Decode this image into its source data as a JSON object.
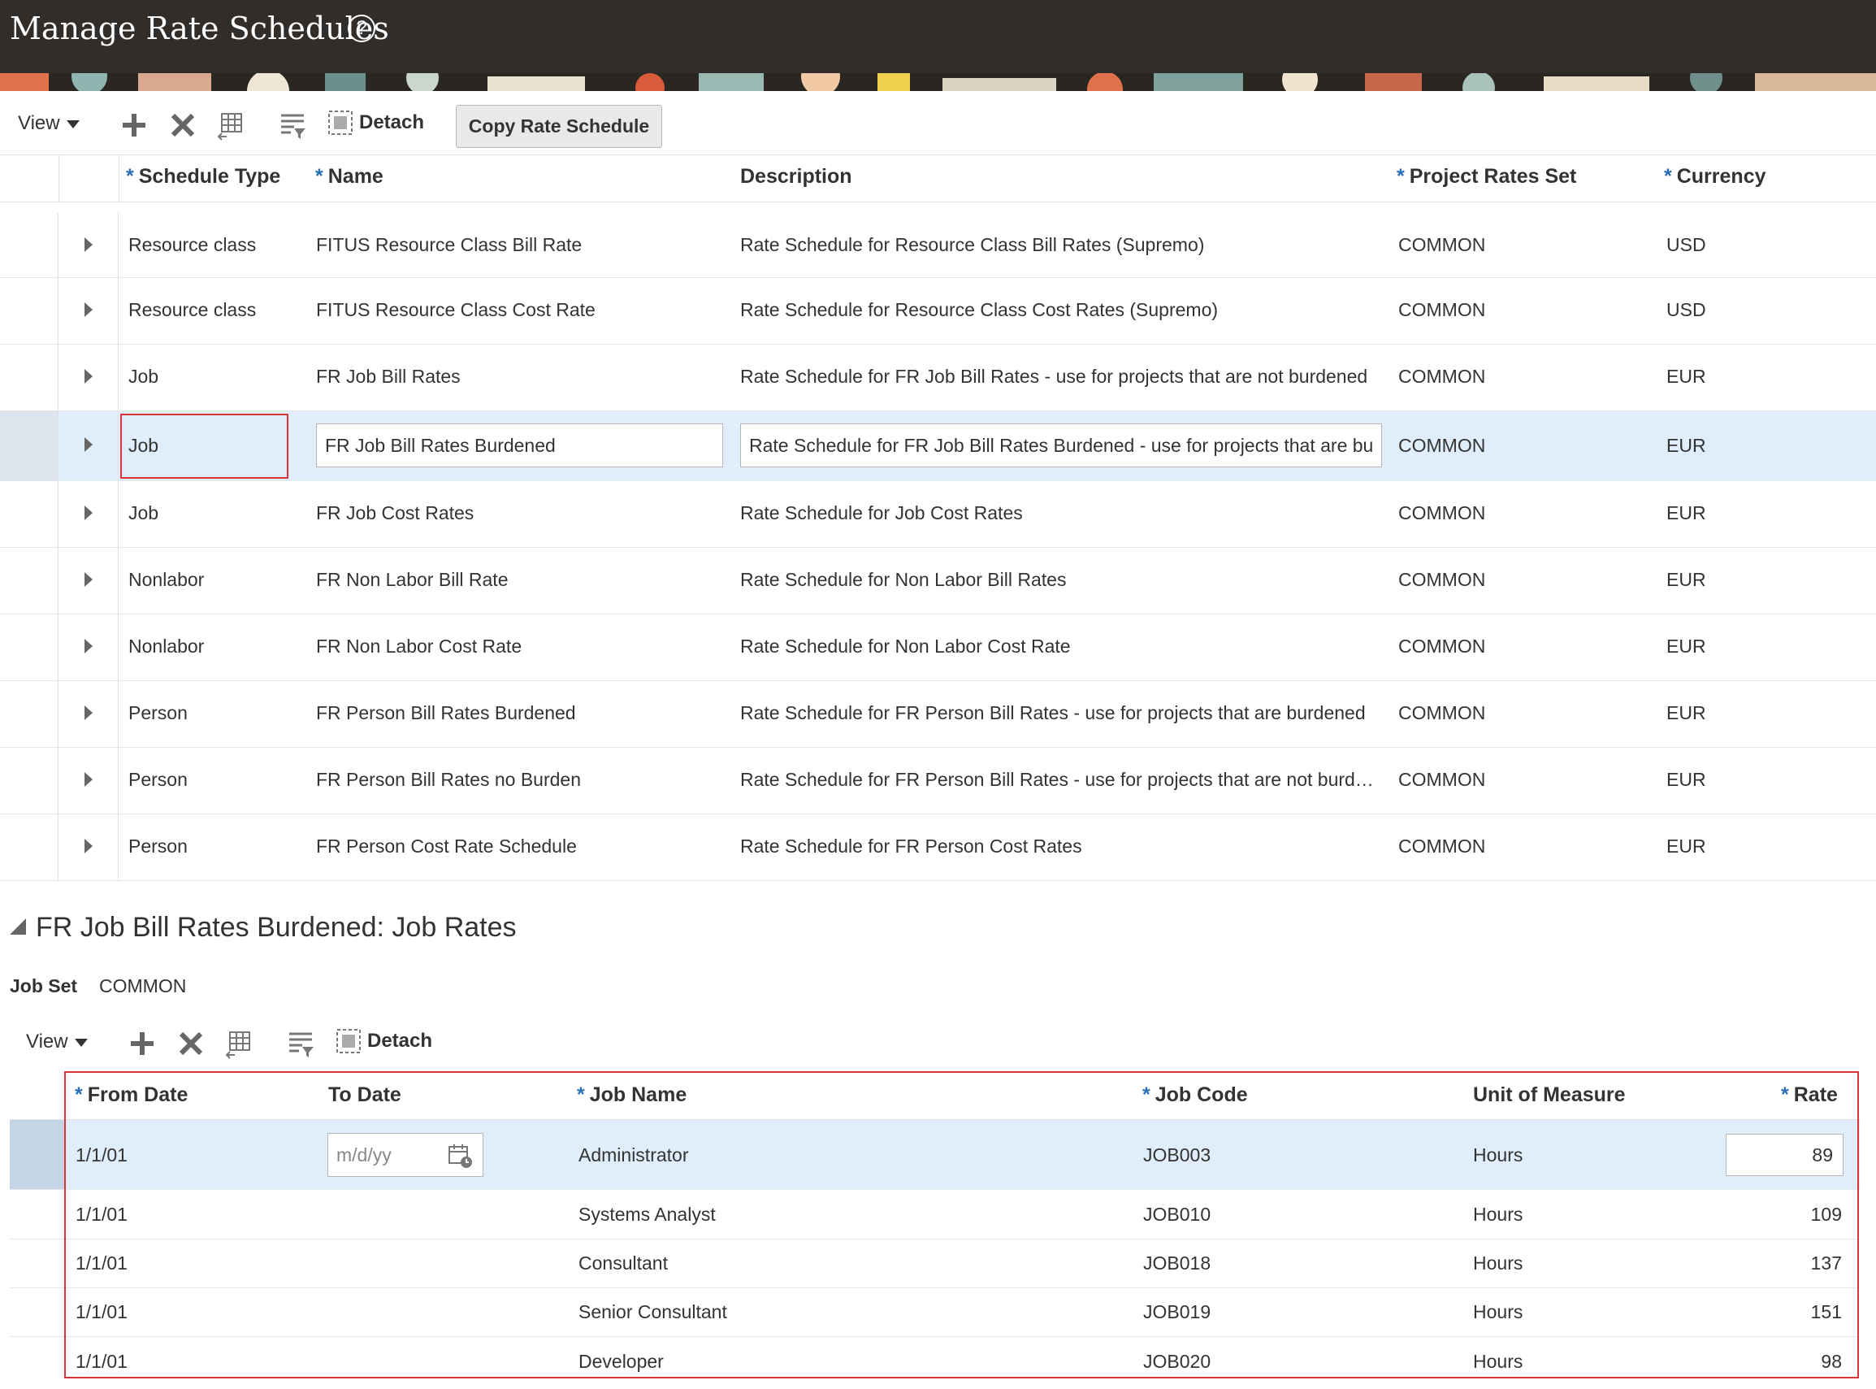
{
  "header": {
    "title": "Manage Rate Schedules",
    "help_symbol": "?"
  },
  "toolbar_top": {
    "view_label": "View",
    "detach_label": "Detach",
    "copy_label": "Copy Rate Schedule"
  },
  "top_table": {
    "columns": {
      "schedule_type": "Schedule Type",
      "name": "Name",
      "description": "Description",
      "rates_set": "Project Rates Set",
      "currency": "Currency"
    },
    "rows": [
      {
        "type": "Resource class",
        "name": "FITUS Resource Class Bill Rate",
        "description": "Rate Schedule for Resource Class Bill Rates (Supremo)",
        "set": "COMMON",
        "currency": "USD"
      },
      {
        "type": "Resource class",
        "name": "FITUS Resource Class Cost Rate",
        "description": "Rate Schedule for Resource Class Cost Rates (Supremo)",
        "set": "COMMON",
        "currency": "USD"
      },
      {
        "type": "Job",
        "name": "FR Job Bill Rates",
        "description": "Rate Schedule for FR Job Bill Rates - use for projects that are not burdened",
        "set": "COMMON",
        "currency": "EUR"
      },
      {
        "type": "Job",
        "name": "FR Job Bill Rates Burdened",
        "description": "Rate Schedule for FR Job Bill Rates Burdened - use for projects that are bu",
        "set": "COMMON",
        "currency": "EUR"
      },
      {
        "type": "Job",
        "name": "FR Job Cost Rates",
        "description": "Rate Schedule for Job Cost Rates",
        "set": "COMMON",
        "currency": "EUR"
      },
      {
        "type": "Nonlabor",
        "name": "FR Non Labor Bill Rate",
        "description": "Rate Schedule for Non Labor Bill Rates",
        "set": "COMMON",
        "currency": "EUR"
      },
      {
        "type": "Nonlabor",
        "name": "FR Non Labor Cost Rate",
        "description": "Rate Schedule for Non Labor Cost Rate",
        "set": "COMMON",
        "currency": "EUR"
      },
      {
        "type": "Person",
        "name": "FR Person Bill Rates Burdened",
        "description": "Rate Schedule for FR Person Bill Rates - use for projects that are burdened",
        "set": "COMMON",
        "currency": "EUR"
      },
      {
        "type": "Person",
        "name": "FR Person Bill Rates no Burden",
        "description": "Rate Schedule for FR Person Bill Rates - use for projects that are not burd…",
        "set": "COMMON",
        "currency": "EUR"
      },
      {
        "type": "Person",
        "name": "FR Person Cost Rate Schedule",
        "description": "Rate Schedule for FR Person Cost Rates",
        "set": "COMMON",
        "currency": "EUR"
      }
    ]
  },
  "section": {
    "title": "FR Job Bill Rates Burdened: Job Rates",
    "job_set_label": "Job Set",
    "job_set_value": "COMMON"
  },
  "toolbar_bottom": {
    "view_label": "View",
    "detach_label": "Detach"
  },
  "bottom_table": {
    "columns": {
      "from_date": "From Date",
      "to_date": "To Date",
      "job_name": "Job Name",
      "job_code": "Job Code",
      "uom": "Unit of Measure",
      "rate": "Rate"
    },
    "date_placeholder": "m/d/yy",
    "rows": [
      {
        "from": "1/1/01",
        "job": "Administrator",
        "code": "JOB003",
        "uom": "Hours",
        "rate": "89"
      },
      {
        "from": "1/1/01",
        "job": "Systems Analyst",
        "code": "JOB010",
        "uom": "Hours",
        "rate": "109"
      },
      {
        "from": "1/1/01",
        "job": "Consultant",
        "code": "JOB018",
        "uom": "Hours",
        "rate": "137"
      },
      {
        "from": "1/1/01",
        "job": "Senior Consultant",
        "code": "JOB019",
        "uom": "Hours",
        "rate": "151"
      },
      {
        "from": "1/1/01",
        "job": "Developer",
        "code": "JOB020",
        "uom": "Hours",
        "rate": "98"
      }
    ]
  },
  "colors": {
    "header_bg": "#312d2a",
    "selected_row": "#dfeefa",
    "highlight_border": "#d9353a",
    "required_star": "#2a6fb5"
  }
}
